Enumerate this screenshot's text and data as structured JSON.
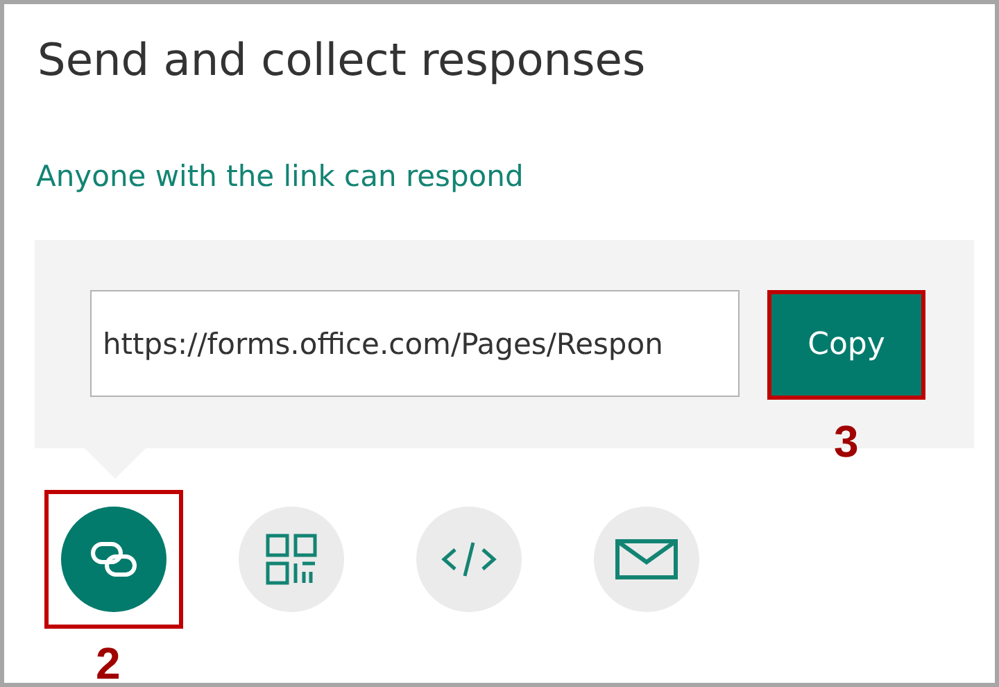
{
  "title": "Send and collect responses",
  "access_note": "Anyone with the link can respond",
  "link_field": {
    "value": "https://forms.office.com/Pages/Respon"
  },
  "copy_button": {
    "label": "Copy",
    "callout": "3"
  },
  "share_options": [
    {
      "kind": "link",
      "selected": true,
      "callout": "2"
    },
    {
      "kind": "qr",
      "selected": false
    },
    {
      "kind": "embed",
      "selected": false
    },
    {
      "kind": "email",
      "selected": false
    }
  ]
}
